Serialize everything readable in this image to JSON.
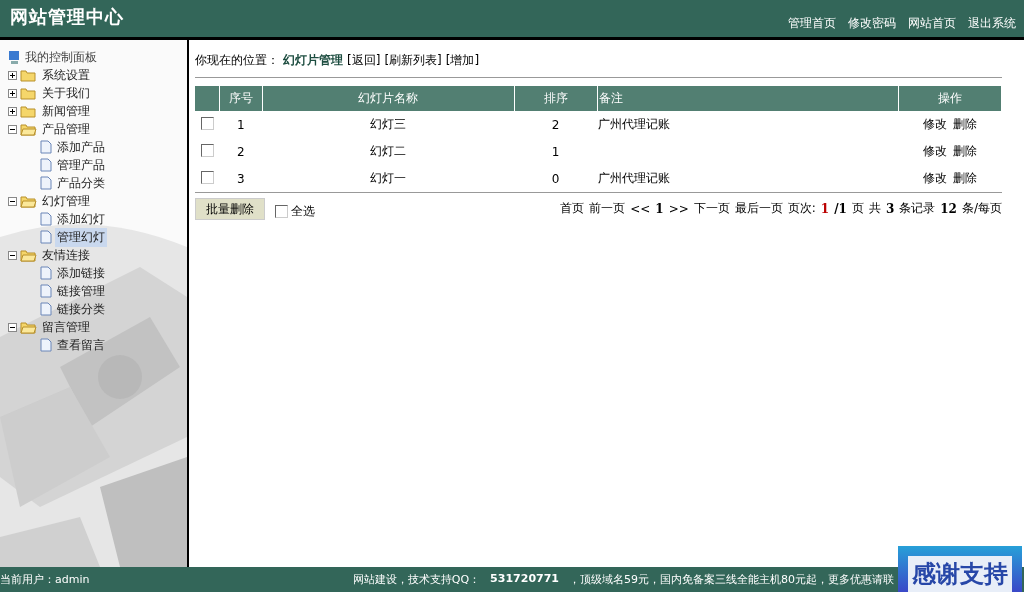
{
  "header": {
    "title": "网站管理中心",
    "links": [
      "管理首页",
      "修改密码",
      "网站首页",
      "退出系统"
    ]
  },
  "sidebar": {
    "root": "我的控制面板",
    "items": [
      {
        "label": "系统设置",
        "expanded": false,
        "selected": false
      },
      {
        "label": "关于我们",
        "expanded": false,
        "selected": false
      },
      {
        "label": "新闻管理",
        "expanded": false,
        "selected": false
      },
      {
        "label": "产品管理",
        "expanded": true,
        "selected": false,
        "children": [
          {
            "label": "添加产品",
            "selected": false
          },
          {
            "label": "管理产品",
            "selected": false
          },
          {
            "label": "产品分类",
            "selected": false
          }
        ]
      },
      {
        "label": "幻灯管理",
        "expanded": true,
        "selected": false,
        "children": [
          {
            "label": "添加幻灯",
            "selected": false
          },
          {
            "label": "管理幻灯",
            "selected": true
          }
        ]
      },
      {
        "label": "友情连接",
        "expanded": true,
        "selected": false,
        "children": [
          {
            "label": "添加链接",
            "selected": false
          },
          {
            "label": "链接管理",
            "selected": false
          },
          {
            "label": "链接分类",
            "selected": false
          }
        ]
      },
      {
        "label": "留言管理",
        "expanded": true,
        "selected": false,
        "children": [
          {
            "label": "查看留言",
            "selected": false
          }
        ]
      }
    ]
  },
  "breadcrumb": {
    "label": "你现在的位置：",
    "current": "幻灯片管理",
    "actions": [
      "[返回]",
      "[刷新列表]",
      "[增加]"
    ]
  },
  "table": {
    "columns": [
      "序号",
      "幻灯片名称",
      "排序",
      "备注",
      "操作"
    ],
    "rows": [
      {
        "checked": false,
        "index": "1",
        "name": "幻灯三",
        "order": "2",
        "note": "广州代理记账",
        "actions": [
          "修改",
          "删除"
        ]
      },
      {
        "checked": false,
        "index": "2",
        "name": "幻灯二",
        "order": "1",
        "note": "",
        "actions": [
          "修改",
          "删除"
        ]
      },
      {
        "checked": false,
        "index": "3",
        "name": "幻灯一",
        "order": "0",
        "note": "广州代理记账",
        "actions": [
          "修改",
          "删除"
        ]
      }
    ]
  },
  "bulk_delete": "批量删除",
  "select_all": {
    "label": "全选",
    "checked": false
  },
  "pager": [
    {
      "kind": "link",
      "text": "首页"
    },
    {
      "kind": "link",
      "text": "前一页"
    },
    {
      "kind": "link",
      "text": "<<"
    },
    {
      "kind": "bold",
      "text": "1"
    },
    {
      "kind": "link",
      "text": ">>"
    },
    {
      "kind": "link",
      "text": "下一页"
    },
    {
      "kind": "link",
      "text": "最后一页"
    },
    {
      "kind": "text",
      "text": "页次:"
    },
    {
      "kind": "current",
      "text": "1"
    },
    {
      "kind": "bold",
      "text": "/1"
    },
    {
      "kind": "text",
      "text": "页"
    },
    {
      "kind": "text",
      "text": "共"
    },
    {
      "kind": "bold",
      "text": "3"
    },
    {
      "kind": "text",
      "text": "条记录"
    },
    {
      "kind": "bold",
      "text": "12"
    },
    {
      "kind": "text",
      "text": "条/每页"
    }
  ],
  "status_bar": {
    "user_label": "当前用户：",
    "user": "admin",
    "support": "网站建设，技术支持QQ：",
    "qq": "531720771",
    "promo": "，顶级域名59元，国内免备案三线全能主机80元起，更多优惠请联"
  },
  "badge": "感谢支持"
}
